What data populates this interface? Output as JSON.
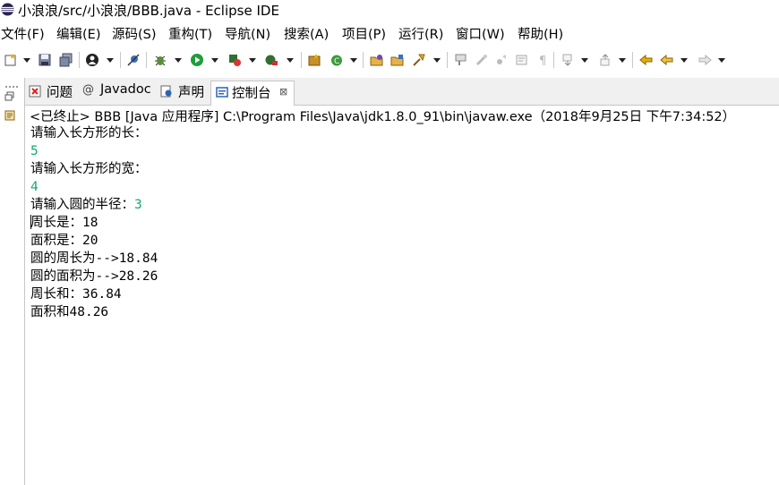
{
  "window": {
    "title": "小浪浪/src/小浪浪/BBB.java - Eclipse IDE"
  },
  "menu": [
    "文件(F)",
    "编辑(E)",
    "源码(S)",
    "重构(T)",
    "导航(N)",
    "搜索(A)",
    "项目(P)",
    "运行(R)",
    "窗口(W)",
    "帮助(H)"
  ],
  "tabs": {
    "problems": "问题",
    "javadoc": "Javadoc",
    "declaration": "声明",
    "console": "控制台",
    "console_close": "⊠"
  },
  "console": {
    "header": "<已终止> BBB [Java 应用程序] C:\\Program Files\\Java\\jdk1.8.0_91\\bin\\javaw.exe（2018年9月25日 下午7:34:52）",
    "lines": [
      {
        "prompt": "请输入长方形的长：",
        "input": ""
      },
      {
        "prompt": "",
        "input": "5"
      },
      {
        "prompt": "请输入长方形的宽：",
        "input": ""
      },
      {
        "prompt": "",
        "input": "4"
      },
      {
        "prompt": "请输入圆的半径：",
        "input": "3"
      },
      {
        "prompt": "周长是：18",
        "input": ""
      },
      {
        "prompt": "面积是：20",
        "input": ""
      },
      {
        "prompt": "圆的周长为-->18.84",
        "input": ""
      },
      {
        "prompt": "圆的面积为-->28.26",
        "input": ""
      },
      {
        "prompt": "周长和：36.84",
        "input": ""
      },
      {
        "prompt": "面积和48.26",
        "input": ""
      }
    ]
  },
  "colors": {
    "input_text": "#17a673",
    "accent": "#2d64b3"
  }
}
